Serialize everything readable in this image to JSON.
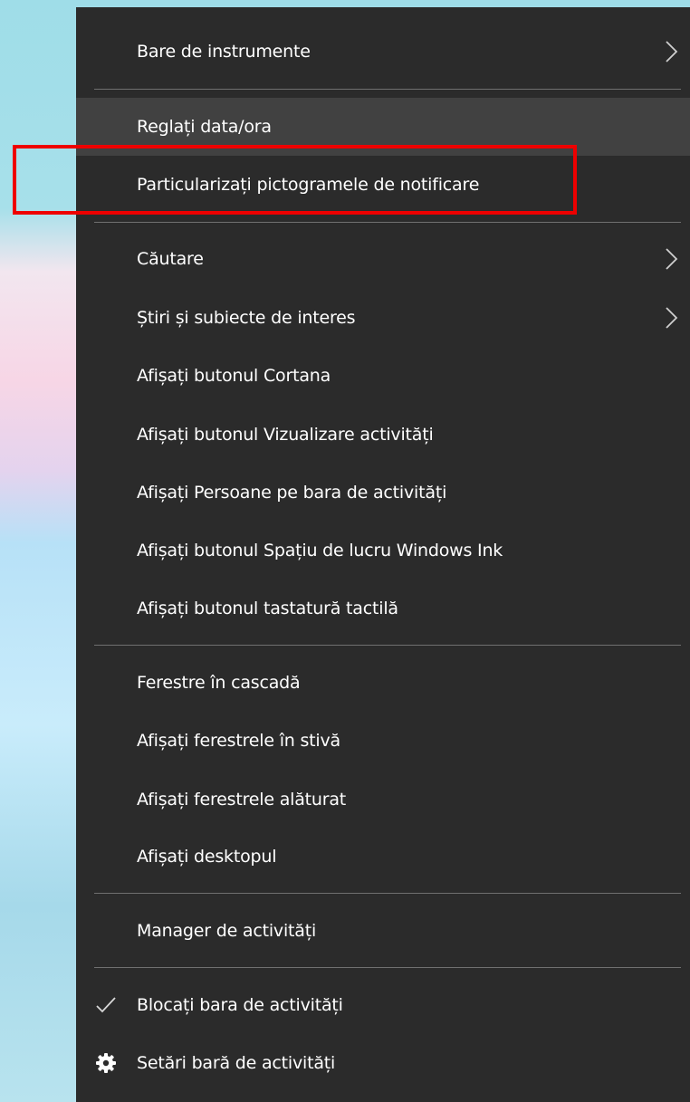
{
  "menu": {
    "items": [
      {
        "label": "Bare de instrumente"
      },
      {
        "label": "Reglați data/ora"
      },
      {
        "label": "Particularizați pictogramele de notificare"
      },
      {
        "label": "Căutare"
      },
      {
        "label": "Știri și subiecte de interes"
      },
      {
        "label": "Afișați butonul Cortana"
      },
      {
        "label": "Afișați butonul Vizualizare activități"
      },
      {
        "label": "Afișați Persoane pe bara de activități"
      },
      {
        "label": "Afișați butonul Spațiu de lucru Windows Ink"
      },
      {
        "label": "Afișați butonul tastatură tactilă"
      },
      {
        "label": "Ferestre în cascadă"
      },
      {
        "label": "Afișați ferestrele în stivă"
      },
      {
        "label": "Afișați ferestrele alăturat"
      },
      {
        "label": "Afișați desktopul"
      },
      {
        "label": "Manager de activități"
      },
      {
        "label": "Blocați bara de activități"
      },
      {
        "label": "Setări bară de activități"
      }
    ]
  },
  "colors": {
    "menu_bg": "#2b2b2b",
    "hover_bg": "#414141",
    "separator": "#707070",
    "highlight_box": "#ee0000",
    "text": "#ffffff"
  },
  "icons": {
    "submenu": "chevron-right-icon",
    "checked": "checkmark-icon",
    "settings": "gear-icon"
  }
}
